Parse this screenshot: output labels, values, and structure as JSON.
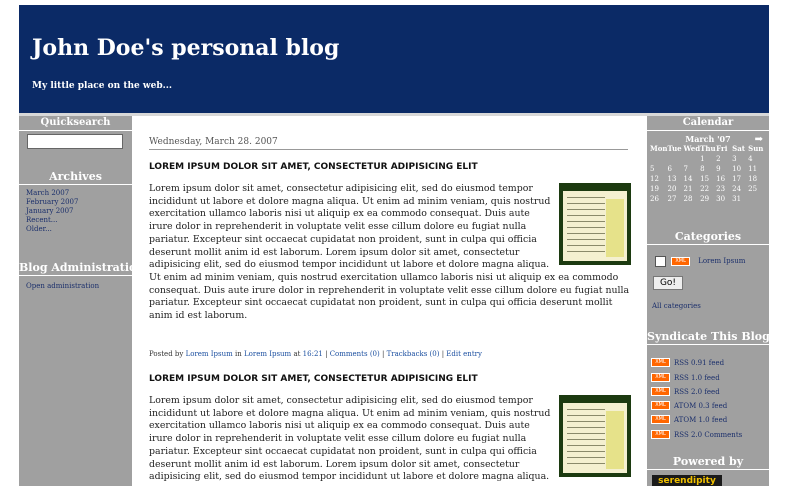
{
  "header": {
    "title": "John Doe's personal blog",
    "description": "My little place on the web..."
  },
  "left_sidebar": {
    "quicksearch_title": "Quicksearch",
    "archives_title": "Archives",
    "archives": [
      "March 2007",
      "February 2007",
      "January 2007",
      "Recent...",
      "Older..."
    ],
    "admin_title": "Blog Administration",
    "admin_link": "Open administration"
  },
  "main": {
    "date": "Wednesday, March 28. 2007",
    "entries": [
      {
        "title": "LOREM IPSUM DOLOR SIT AMET, CONSECTETUR ADIPISICING ELIT",
        "body": "Lorem ipsum dolor sit amet, consectetur adipisicing elit, sed do eiusmod tempor incididunt ut labore et dolore magna aliqua. Ut enim ad minim veniam, quis nostrud exercitation ullamco laboris nisi ut aliquip ex ea commodo consequat. Duis aute irure dolor in reprehenderit in voluptate velit esse cillum dolore eu fugiat nulla pariatur. Excepteur sint occaecat cupidatat non proident, sunt in culpa qui officia deserunt mollit anim id est laborum. Lorem ipsum dolor sit amet, consectetur adipisicing elit, sed do eiusmod tempor incididunt ut labore et dolore magna aliqua. Ut enim ad minim veniam, quis nostrud exercitation ullamco laboris nisi ut aliquip ex ea commodo consequat. Duis aute irure dolor in reprehenderit in voluptate velit esse cillum dolore eu fugiat nulla pariatur. Excepteur sint occaecat cupidatat non proident, sunt in culpa qui officia deserunt mollit anim id est laborum.",
        "posted_by": "Posted by",
        "author": "Lorem Ipsum",
        "in": "in",
        "category": "Lorem Ipsum",
        "at": "at",
        "time": "16:21",
        "comments": "Comments (0)",
        "trackbacks": "Trackbacks (0)",
        "edit": "Edit entry",
        "sep": "|"
      },
      {
        "title": "LOREM IPSUM DOLOR SIT AMET, CONSECTETUR ADIPISICING ELIT",
        "body": "Lorem ipsum dolor sit amet, consectetur adipisicing elit, sed do eiusmod tempor incididunt ut labore et dolore magna aliqua. Ut enim ad minim veniam, quis nostrud exercitation ullamco laboris nisi ut aliquip ex ea commodo consequat. Duis aute irure dolor in reprehenderit in voluptate velit esse cillum dolore eu fugiat nulla pariatur. Excepteur sint occaecat cupidatat non proident, sunt in culpa qui officia deserunt mollit anim id est laborum. Lorem ipsum dolor sit amet, consectetur adipisicing elit, sed do eiusmod tempor incididunt ut labore et dolore magna aliqua."
      }
    ]
  },
  "right_sidebar": {
    "calendar_title": "Calendar",
    "calendar_month": "March '07",
    "calendar_next": "➡",
    "days_of_week": [
      "Mon",
      "Tue",
      "Wed",
      "Thu",
      "Fri",
      "Sat",
      "Sun"
    ],
    "weeks": [
      [
        "",
        "",
        "",
        "1",
        "2",
        "3",
        "4"
      ],
      [
        "5",
        "6",
        "7",
        "8",
        "9",
        "10",
        "11"
      ],
      [
        "12",
        "13",
        "14",
        "15",
        "16",
        "17",
        "18"
      ],
      [
        "19",
        "20",
        "21",
        "22",
        "23",
        "24",
        "25"
      ],
      [
        "26",
        "27",
        "28",
        "29",
        "30",
        "31",
        ""
      ]
    ],
    "categories_title": "Categories",
    "category_item": "Lorem Ipsum",
    "go_label": "Go!",
    "all_categories": "All categories",
    "syndicate_title": "Syndicate This Blog",
    "xml_label": "XML",
    "feeds": [
      "RSS 0.91 feed",
      "RSS 1.0 feed",
      "RSS 2.0 feed",
      "ATOM 0.3 feed",
      "ATOM 1.0 feed",
      "RSS 2.0 Comments"
    ],
    "powered_title": "Powered by",
    "powered_logo": "serendipity"
  },
  "colors": {
    "header_bg": "#0b2a66",
    "sidebar_bg": "#a0a0a0",
    "link": "#1b2f6b",
    "xml_badge": "#ff6600"
  }
}
